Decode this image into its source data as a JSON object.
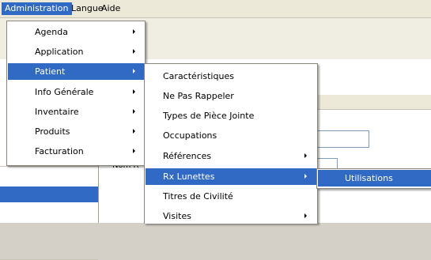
{
  "menubar": {
    "items": [
      {
        "label": "Administration",
        "active": true
      },
      {
        "label": "Langue",
        "active": false
      },
      {
        "label": "Aide",
        "active": false
      }
    ]
  },
  "admin_menu": {
    "items": [
      {
        "label": "Agenda",
        "submenu": true
      },
      {
        "label": "Application",
        "submenu": true
      },
      {
        "label": "Patient",
        "submenu": true,
        "highlighted": true
      },
      {
        "label": "Info Générale",
        "submenu": true
      },
      {
        "label": "Inventaire",
        "submenu": true
      },
      {
        "label": "Produits",
        "submenu": true
      },
      {
        "label": "Facturation",
        "submenu": true
      }
    ]
  },
  "patient_menu": {
    "items": [
      {
        "label": "Caractéristiques",
        "submenu": false
      },
      {
        "label": "Ne Pas Rappeler",
        "submenu": false
      },
      {
        "label": "Types de Pièce Jointe",
        "submenu": false
      },
      {
        "label": "Occupations",
        "submenu": false
      },
      {
        "label": "Références",
        "submenu": true
      },
      {
        "label": "Rx Lunettes",
        "submenu": true,
        "highlighted": true
      },
      {
        "label": "Titres de Civilité",
        "submenu": false
      },
      {
        "label": "Visites",
        "submenu": true
      }
    ]
  },
  "rx_menu": {
    "items": [
      {
        "label": "Utilisations",
        "highlighted": true
      }
    ]
  },
  "background": {
    "partial_label": "Nom R"
  },
  "colors": {
    "highlight": "#316ac5",
    "menubar": "#ece9d8"
  }
}
